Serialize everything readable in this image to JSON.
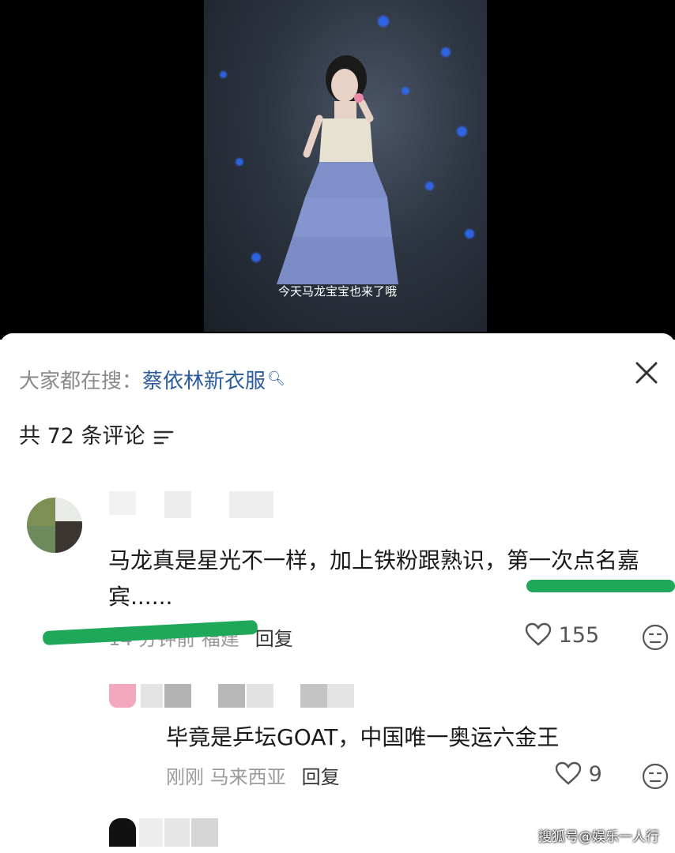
{
  "video": {
    "caption": "今天马龙宝宝也来了哦"
  },
  "search_bar": {
    "label": "大家都在搜：",
    "term": "蔡依林新衣服"
  },
  "comments_header": {
    "count_text": "共 72 条评论"
  },
  "comment": {
    "text": "马龙真是星光不一样，加上铁粉跟熟识，第一次点名嘉宾......",
    "time_location": "14 分钟前 福建",
    "reply_label": "回复",
    "likes": "155"
  },
  "reply": {
    "text": "毕竟是乒坛GOAT，中国唯一奥运六金王",
    "time": "刚刚",
    "location": "马来西亚",
    "reply_label": "回复",
    "likes": "9"
  },
  "watermark": "搜狐号@娱乐一人行",
  "colors": {
    "highlight": "#1fa85a",
    "link": "#2b5b9a",
    "stage_light": "#2f6cff"
  },
  "icons": [
    "search-icon",
    "close-icon",
    "sort-icon",
    "heart-icon",
    "emoji-icon"
  ]
}
